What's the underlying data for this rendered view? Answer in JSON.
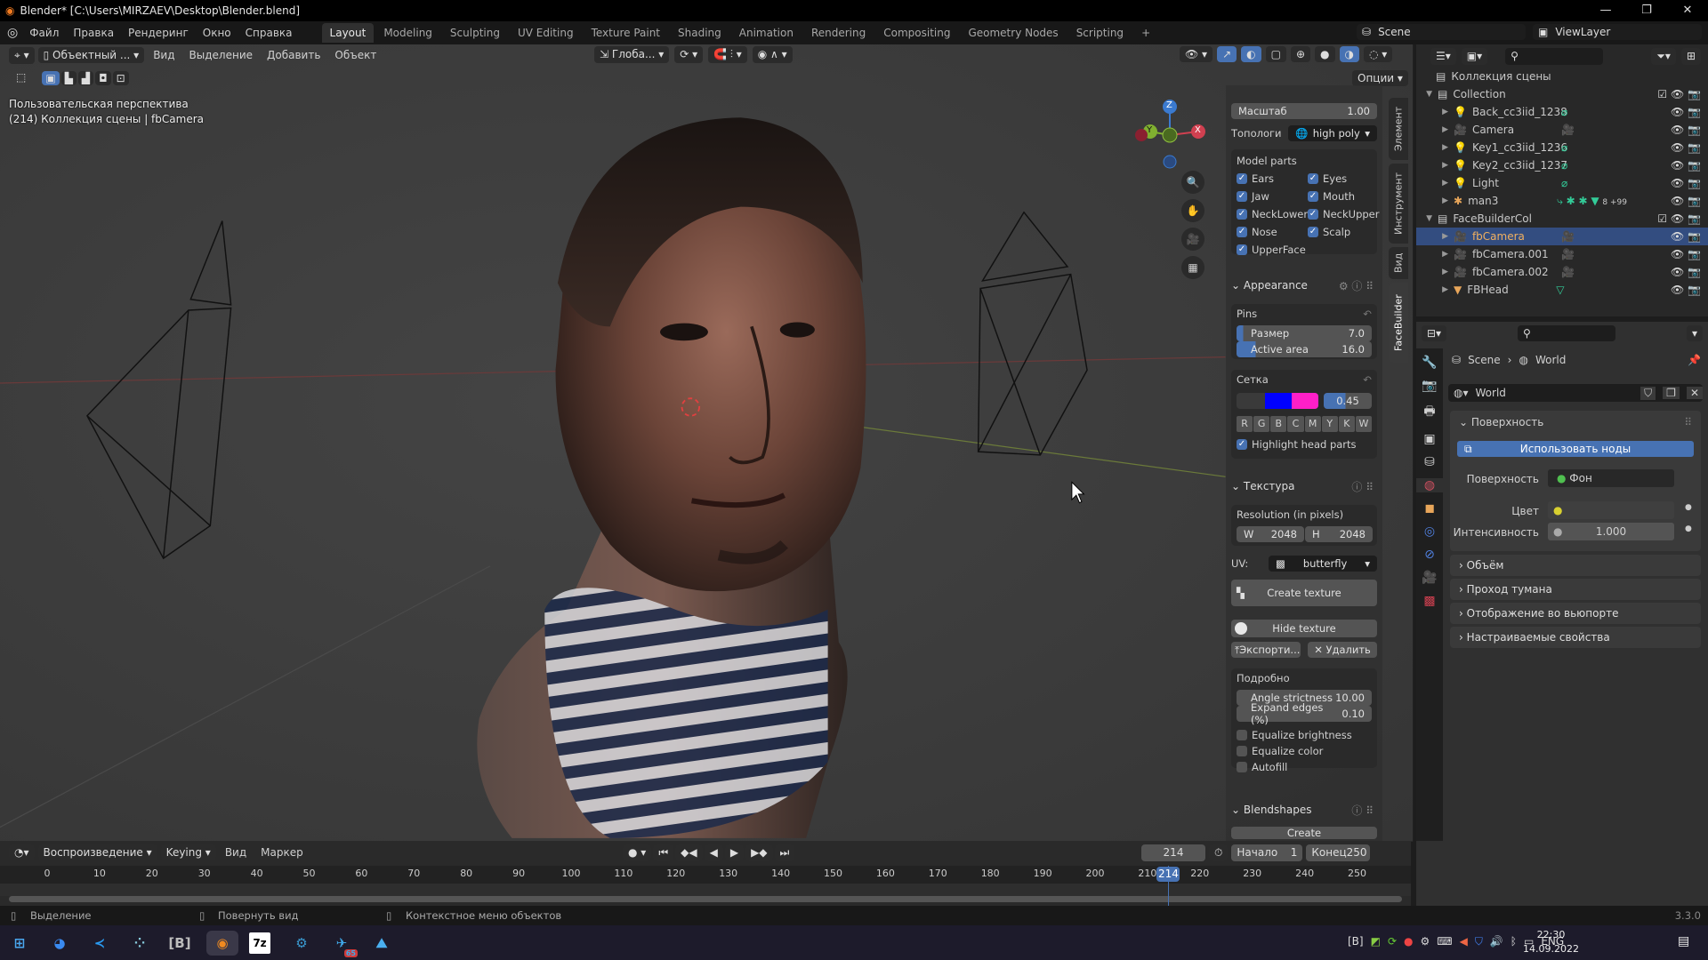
{
  "window": {
    "title": "Blender* [C:\\Users\\MIRZAEV\\Desktop\\Blender.blend]",
    "minimize": "—",
    "maximize": "❐",
    "close": "✕"
  },
  "menu": [
    "Файл",
    "Правка",
    "Рендеринг",
    "Окно",
    "Справка"
  ],
  "workspaces": [
    "Layout",
    "Modeling",
    "Sculpting",
    "UV Editing",
    "Texture Paint",
    "Shading",
    "Animation",
    "Rendering",
    "Compositing",
    "Geometry Nodes",
    "Scripting",
    "+"
  ],
  "scene_selector": {
    "scene": "Scene",
    "view_layer": "ViewLayer"
  },
  "viewport": {
    "mode": "Объектный ...",
    "menus": [
      "Вид",
      "Выделение",
      "Добавить",
      "Объект"
    ],
    "transform_orientation": "Глоба...",
    "options": "Опции",
    "overlay_line1": "Пользовательская перспектива",
    "overlay_line2": "(214) Коллекция сцены | fbCamera",
    "gizmo": {
      "x": "X",
      "y": "Y",
      "z": "Z"
    }
  },
  "npanel": {
    "tabs": [
      "Элемент",
      "Инструмент",
      "Вид",
      "FaceBuilder"
    ],
    "scale_label": "Масштаб",
    "scale_value": "1.00",
    "topology_label": "Топологи",
    "topology_value": "high poly",
    "model_parts_title": "Model parts",
    "model_parts": [
      {
        "label": "Ears",
        "checked": true
      },
      {
        "label": "Eyes",
        "checked": true
      },
      {
        "label": "Jaw",
        "checked": true
      },
      {
        "label": "Mouth",
        "checked": true
      },
      {
        "label": "NeckLower",
        "checked": true
      },
      {
        "label": "NeckUpper",
        "checked": true
      },
      {
        "label": "Nose",
        "checked": true
      },
      {
        "label": "Scalp",
        "checked": true
      },
      {
        "label": "UpperFace",
        "checked": true
      }
    ],
    "appearance": "Appearance",
    "pins": "Pins",
    "pin_size_label": "Размер",
    "pin_size": "7.0",
    "active_area_label": "Active area",
    "active_area": "16.0",
    "mesh": "Сетка",
    "mesh_colors": [
      "#0000ff",
      "#ff1fc8"
    ],
    "mesh_opacity": "0.45",
    "color_buttons": [
      "R",
      "G",
      "B",
      "C",
      "M",
      "Y",
      "K",
      "W"
    ],
    "highlight": "Highlight head parts",
    "texture": "Текстура",
    "resolution": "Resolution (in pixels)",
    "w_label": "W",
    "w": "2048",
    "h_label": "H",
    "h": "2048",
    "uv_label": "UV:",
    "uv_value": "butterfly",
    "create_texture": "Create texture",
    "hide_texture": "Hide texture",
    "export": "Экспорти...",
    "delete": "Удалить",
    "details": "Подробно",
    "angle_label": "Angle strictness",
    "angle": "10.00",
    "expand_label": "Expand edges (%)",
    "expand": "0.10",
    "equalize_brightness": "Equalize brightness",
    "equalize_color": "Equalize color",
    "autofill": "Autofill",
    "blendshapes": "Blendshapes",
    "create": "Create"
  },
  "outliner": {
    "root": "Коллекция сцены",
    "rows": [
      {
        "name": "Collection",
        "type": "collection",
        "level": 0
      },
      {
        "name": "Back_cc3iid_1238",
        "type": "light",
        "level": 1
      },
      {
        "name": "Camera",
        "type": "camera",
        "level": 1
      },
      {
        "name": "Key1_cc3iid_1236",
        "type": "light",
        "level": 1
      },
      {
        "name": "Key2_cc3iid_1237",
        "type": "light",
        "level": 1
      },
      {
        "name": "Light",
        "type": "light",
        "level": 1
      },
      {
        "name": "man3",
        "type": "armature",
        "level": 1,
        "badge": "8  +99"
      },
      {
        "name": "FaceBuilderCol",
        "type": "collection",
        "level": 0
      },
      {
        "name": "fbCamera",
        "type": "camera",
        "level": 1,
        "selected": true
      },
      {
        "name": "fbCamera.001",
        "type": "camera",
        "level": 1
      },
      {
        "name": "fbCamera.002",
        "type": "camera",
        "level": 1
      },
      {
        "name": "FBHead",
        "type": "mesh",
        "level": 1
      }
    ]
  },
  "properties": {
    "breadcrumb": [
      "Scene",
      "World"
    ],
    "world_name": "World",
    "surface_panel": "Поверхность",
    "use_nodes": "Использовать ноды",
    "surface_label": "Поверхность",
    "surface_value": "Фон",
    "color_label": "Цвет",
    "strength_label": "Интенсивность",
    "strength_value": "1.000",
    "collapsed_panels": [
      "Объём",
      "Проход тумана",
      "Отображение во вьюпорте",
      "Настраиваемые свойства"
    ]
  },
  "timeline": {
    "menus": [
      "Воспроизведение",
      "Keying",
      "Вид",
      "Маркер"
    ],
    "current_frame": "214",
    "start_label": "Начало",
    "start": "1",
    "end_label": "Конец",
    "end": "250",
    "ticks": [
      "0",
      "10",
      "20",
      "30",
      "40",
      "50",
      "60",
      "70",
      "80",
      "90",
      "100",
      "110",
      "120",
      "130",
      "140",
      "150",
      "160",
      "170",
      "180",
      "190",
      "200",
      "210",
      "220",
      "230",
      "240",
      "250"
    ]
  },
  "status": {
    "hints": [
      "Выделение",
      "Повернуть вид",
      "Контекстное меню объектов"
    ],
    "version": "3.3.0"
  },
  "taskbar": {
    "apps": [
      "windows-start",
      "firefox",
      "vscode",
      "app",
      "bracket-app",
      "blender",
      "7zip",
      "steam",
      "telegram",
      "photos"
    ],
    "telegram_badge": "65",
    "lang": "ENG",
    "time": "22:30",
    "date": "14.09.2022"
  },
  "colors": {
    "accent": "#4772b3",
    "selected_row": "#334d80",
    "object_orange": "#e8a65a"
  }
}
